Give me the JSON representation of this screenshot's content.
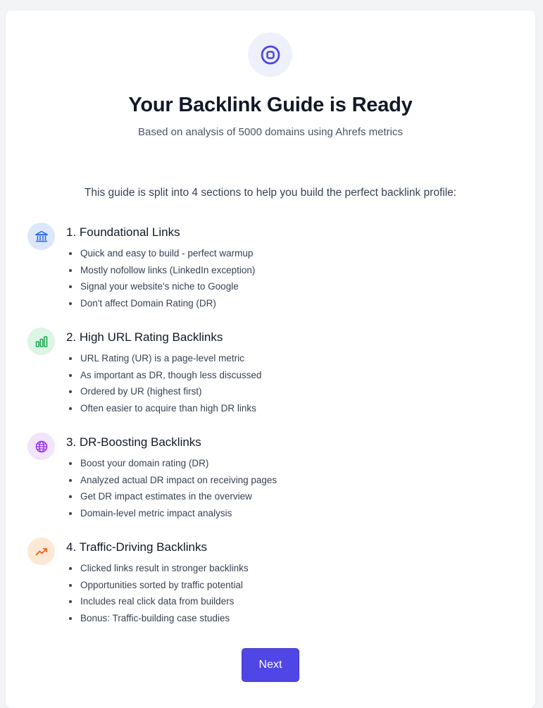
{
  "header": {
    "title": "Your Backlink Guide is Ready",
    "subtitle": "Based on analysis of 5000 domains using Ahrefs metrics",
    "icon": "target-icon"
  },
  "intro": "This guide is split into 4 sections to help you build the perfect backlink profile:",
  "sections": [
    {
      "title": "1. Foundational Links",
      "icon": "bank-icon",
      "icon_color": "#2563eb",
      "icon_bg": "#dbe7fb",
      "bullets": [
        "Quick and easy to build - perfect warmup",
        "Mostly nofollow links (LinkedIn exception)",
        "Signal your website's niche to Google",
        "Don't affect Domain Rating (DR)"
      ]
    },
    {
      "title": "2. High URL Rating Backlinks",
      "icon": "bar-chart-icon",
      "icon_color": "#16a34a",
      "icon_bg": "#dcf5e4",
      "bullets": [
        "URL Rating (UR) is a page-level metric",
        "As important as DR, though less discussed",
        "Ordered by UR (highest first)",
        "Often easier to acquire than high DR links"
      ]
    },
    {
      "title": "3. DR-Boosting Backlinks",
      "icon": "globe-icon",
      "icon_color": "#9333ea",
      "icon_bg": "#f1e4fb",
      "bullets": [
        "Boost your domain rating (DR)",
        "Analyzed actual DR impact on receiving pages",
        "Get DR impact estimates in the overview",
        "Domain-level metric impact analysis"
      ]
    },
    {
      "title": "4. Traffic-Driving Backlinks",
      "icon": "trending-up-icon",
      "icon_color": "#ea580c",
      "icon_bg": "#fde8d6",
      "bullets": [
        "Clicked links result in stronger backlinks",
        "Opportunities sorted by traffic potential",
        "Includes real click data from builders",
        "Bonus: Traffic-building case studies"
      ]
    }
  ],
  "actions": {
    "next_label": "Next"
  },
  "colors": {
    "accent": "#4f46e5",
    "page_bg": "#f3f4f6"
  }
}
